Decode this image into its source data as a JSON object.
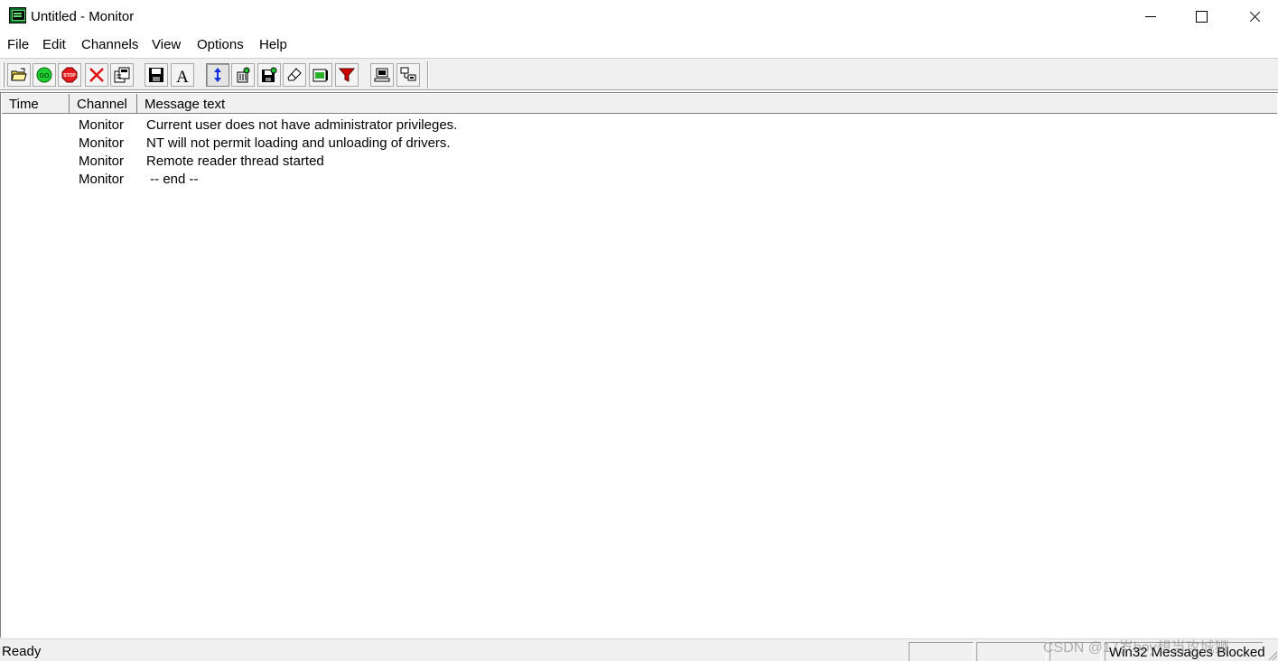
{
  "window": {
    "title": "Untitled - Monitor",
    "app_icon": "monitor-app-icon"
  },
  "menu": {
    "items": [
      "File",
      "Edit",
      "Channels",
      "View",
      "Options",
      "Help"
    ]
  },
  "toolbar": {
    "buttons": [
      {
        "icon": "open-folder-icon"
      },
      {
        "icon": "go-icon"
      },
      {
        "icon": "stop-icon"
      },
      {
        "icon": "delete-icon"
      },
      {
        "icon": "properties-icon"
      },
      {
        "icon": "save-icon"
      },
      {
        "icon": "font-icon"
      },
      {
        "icon": "autoscroll-icon",
        "pressed": true
      },
      {
        "icon": "capture-icon"
      },
      {
        "icon": "log-to-file-icon"
      },
      {
        "icon": "eraser-icon"
      },
      {
        "icon": "clock-time-icon"
      },
      {
        "icon": "filter-icon"
      },
      {
        "icon": "connect-local-icon"
      },
      {
        "icon": "connect-remote-icon"
      }
    ],
    "go_label": "GO",
    "stop_label": "STOP",
    "font_label": "A"
  },
  "list": {
    "columns": [
      "Time",
      "Channel",
      "Message text"
    ],
    "rows": [
      {
        "time": "",
        "channel": "Monitor",
        "message": "Current user does not have administrator privileges."
      },
      {
        "time": "",
        "channel": "Monitor",
        "message": "NT will not permit loading and unloading of drivers."
      },
      {
        "time": "",
        "channel": "Monitor",
        "message": "Remote reader thread started"
      },
      {
        "time": "",
        "channel": "Monitor",
        "message": " -- end --"
      }
    ]
  },
  "status": {
    "text": "Ready",
    "pane4": "Win32 Messages Blocked"
  },
  "watermark": "CSDN @17岁boy想当攻城狮"
}
